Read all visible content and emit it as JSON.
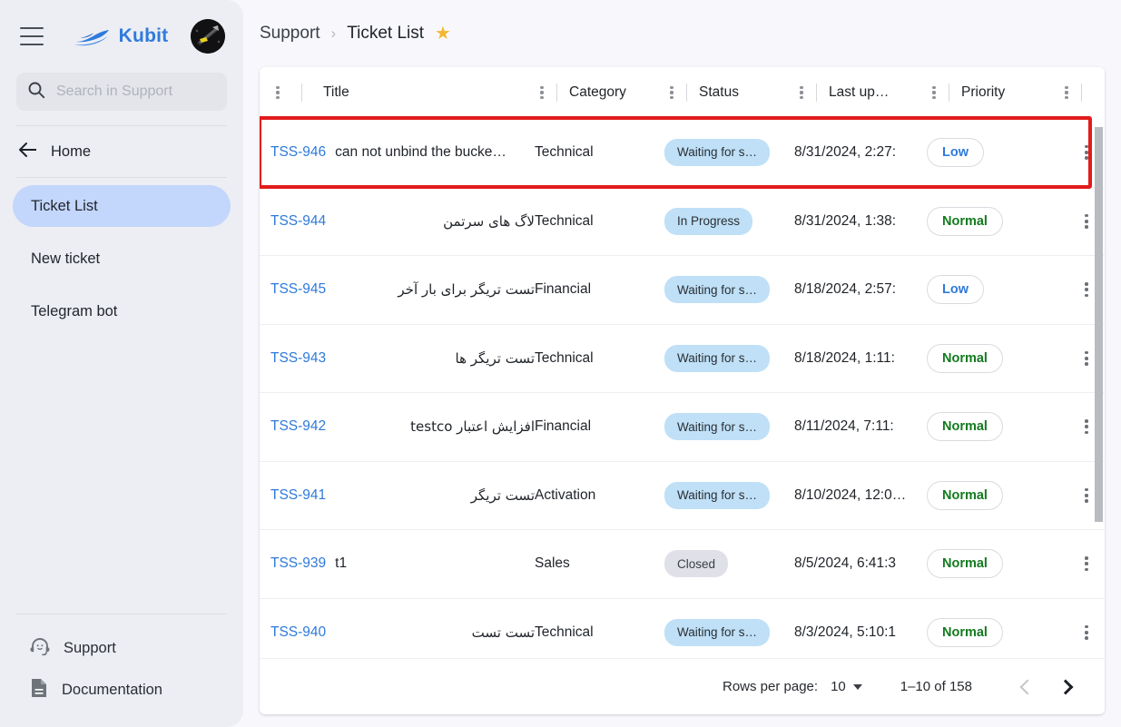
{
  "app": {
    "brand_name": "Kubit",
    "brand_logo_icon": "speedboat-logo-icon",
    "menu_icon": "hamburger-menu-icon",
    "avatar_icon": "user-avatar"
  },
  "sidebar": {
    "search": {
      "placeholder": "Search in Support",
      "value": "",
      "icon": "search-icon"
    },
    "home": {
      "label": "Home",
      "icon": "arrow-left-icon"
    },
    "items": [
      {
        "label": "Ticket List",
        "active": true
      },
      {
        "label": "New ticket",
        "active": false
      },
      {
        "label": "Telegram bot",
        "active": false
      }
    ],
    "bottom_items": [
      {
        "label": "Support",
        "icon": "headset-support-icon"
      },
      {
        "label": "Documentation",
        "icon": "document-icon"
      }
    ]
  },
  "breadcrumb": {
    "parent": "Support",
    "separator": "›",
    "current": "Ticket List",
    "star_icon": "star-filled-icon",
    "star_glyph": "★"
  },
  "table": {
    "columns": [
      {
        "label": "Title"
      },
      {
        "label": "Category"
      },
      {
        "label": "Status"
      },
      {
        "label": "Last up…"
      },
      {
        "label": "Priority"
      },
      {
        "label": ""
      }
    ],
    "rows": [
      {
        "id": "TSS-946",
        "title": "can not unbind the bucke…",
        "rtl": false,
        "category": "Technical",
        "status": "Waiting for s…",
        "status_kind": "waiting",
        "updated": "8/31/2024, 2:27:",
        "priority": "Low",
        "priority_kind": "low",
        "highlighted": true
      },
      {
        "id": "TSS-944",
        "title": "لاگ های سرتمن",
        "rtl": true,
        "category": "Technical",
        "status": "In Progress",
        "status_kind": "progress",
        "updated": "8/31/2024, 1:38:",
        "priority": "Normal",
        "priority_kind": "normal",
        "highlighted": false
      },
      {
        "id": "TSS-945",
        "title": "تست تریگر برای بار آخر",
        "rtl": true,
        "category": "Financial",
        "status": "Waiting for s…",
        "status_kind": "waiting",
        "updated": "8/18/2024, 2:57:",
        "priority": "Low",
        "priority_kind": "low",
        "highlighted": false
      },
      {
        "id": "TSS-943",
        "title": "تست تریگر ها",
        "rtl": true,
        "category": "Technical",
        "status": "Waiting for s…",
        "status_kind": "waiting",
        "updated": "8/18/2024, 1:11:",
        "priority": "Normal",
        "priority_kind": "normal",
        "highlighted": false
      },
      {
        "id": "TSS-942",
        "title": "افزایش اعتبار testco",
        "rtl": true,
        "category": "Financial",
        "status": "Waiting for s…",
        "status_kind": "waiting",
        "updated": "8/11/2024, 7:11:",
        "priority": "Normal",
        "priority_kind": "normal",
        "highlighted": false
      },
      {
        "id": "TSS-941",
        "title": "تست تریگر",
        "rtl": true,
        "category": "Activation",
        "status": "Waiting for s…",
        "status_kind": "waiting",
        "updated": "8/10/2024, 12:0…",
        "priority": "Normal",
        "priority_kind": "normal",
        "highlighted": false
      },
      {
        "id": "TSS-939",
        "title": "t1",
        "rtl": false,
        "category": "Sales",
        "status": "Closed",
        "status_kind": "closed",
        "updated": "8/5/2024, 6:41:3",
        "priority": "Normal",
        "priority_kind": "normal",
        "highlighted": false
      },
      {
        "id": "TSS-940",
        "title": "تست تست",
        "rtl": true,
        "category": "Technical",
        "status": "Waiting for s…",
        "status_kind": "waiting",
        "updated": "8/3/2024, 5:10:1",
        "priority": "Normal",
        "priority_kind": "normal",
        "highlighted": false
      }
    ],
    "row_menu_icon": "more-vertical-icon",
    "column_menu_icon": "more-vertical-icon"
  },
  "pagination": {
    "rows_per_page_label": "Rows per page:",
    "rows_per_page_value": "10",
    "range": "1–10 of 158",
    "prev_icon": "chevron-left-icon",
    "next_icon": "chevron-right-icon"
  },
  "colors": {
    "accent_blue": "#2f7ada",
    "highlight_red": "#e21b1b",
    "sidebar_bg": "#eceef3",
    "active_nav": "#c3d6fb",
    "chip_blue": "#bfe0f7",
    "chip_gray": "#e0e1e8",
    "priority_green": "#137a1f",
    "star_gold": "#f5b731"
  }
}
